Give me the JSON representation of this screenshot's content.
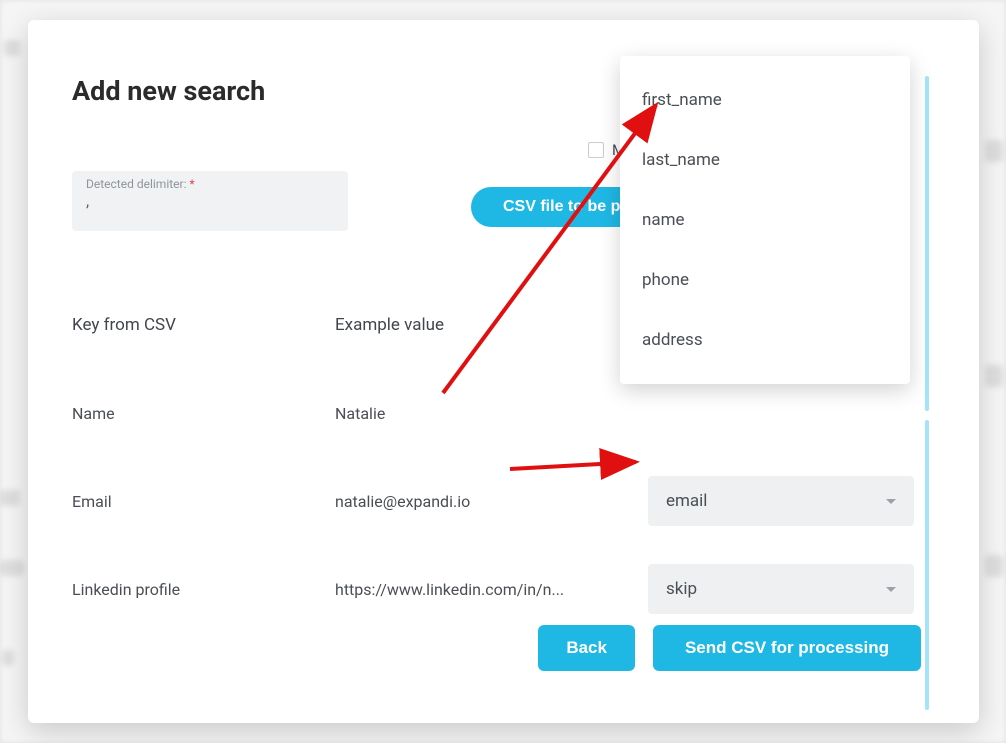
{
  "modal": {
    "title": "Add new search",
    "checkbox_partial_label": "Ma",
    "delimiter": {
      "label": "Detected delimiter:",
      "value": ","
    },
    "parse_button": "CSV file to be parsed",
    "columns": {
      "key_header": "Key from CSV",
      "example_header": "Example value"
    },
    "rows": [
      {
        "key": "Name",
        "example": "Natalie",
        "select": ""
      },
      {
        "key": "Email",
        "example": "natalie@expandi.io",
        "select": "email"
      },
      {
        "key": "Linkedin profile",
        "example": "https://www.linkedin.com/in/n...",
        "select": "skip"
      }
    ],
    "footer": {
      "back": "Back",
      "send": "Send CSV for processing"
    }
  },
  "dropdown": {
    "options": [
      "first_name",
      "last_name",
      "name",
      "phone",
      "address"
    ]
  }
}
